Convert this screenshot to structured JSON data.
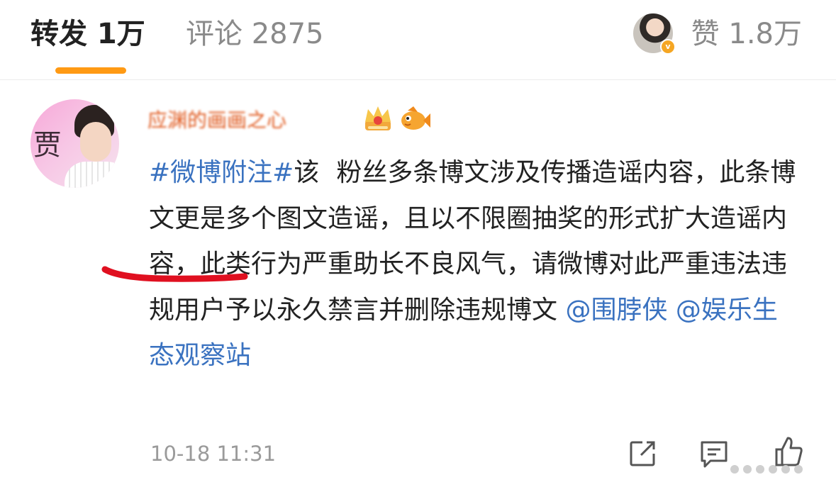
{
  "tabs": {
    "repost": "转发 1万",
    "comment": "评论 2875",
    "like": "赞 1.8万",
    "accent": "#ff9a14"
  },
  "post": {
    "username": "应渊的画画之心",
    "text_parts": [
      "#微博附注#",
      "该",
      "粉丝多条博文涉及传播造谣内容，此条博文更是多个图文造谣，且以不限圈抽奖的形式扩大造谣内容，此类行为严重助长不良风气，请微博对此严重违法违规用户予以永久禁言并删除违规博文 ",
      "@围脖侠",
      " ",
      "@娱乐生态观察站"
    ],
    "timestamp": "10-18 11:31",
    "link_color": "#3a72c0",
    "annotation_color": "#e01020"
  },
  "icons": [
    "avatar-image",
    "verified-badge",
    "crown-icon",
    "fish-icon",
    "share-icon",
    "comment-icon",
    "like-icon"
  ]
}
